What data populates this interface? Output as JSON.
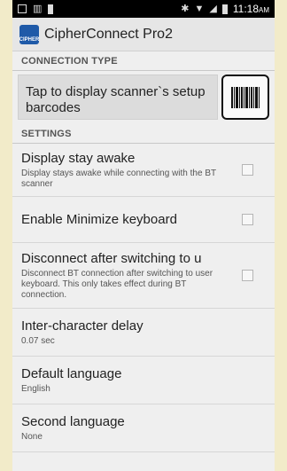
{
  "status_bar": {
    "time": "11:18",
    "ampm": "AM",
    "left_icons": [
      "screenshot-icon",
      "barcode-notification-icon",
      "sd-icon"
    ],
    "right_icons": [
      "bluetooth-icon",
      "wifi-icon",
      "signal-icon",
      "battery-icon"
    ]
  },
  "action_bar": {
    "title": "CipherConnect Pro2",
    "logo_text": "CIPHER"
  },
  "connection_type": {
    "header": "CONNECTION TYPE",
    "tap_text": "Tap to display scanner`s setup barcodes"
  },
  "settings": {
    "header": "SETTINGS",
    "items": [
      {
        "title": "Display stay awake",
        "summary": "Display stays awake while connecting with the BT scanner",
        "checked": false
      },
      {
        "title": "Enable Minimize keyboard",
        "summary": "",
        "checked": false
      },
      {
        "title": "Disconnect after switching to u",
        "summary": "Disconnect BT connection after switching to user keyboard. This only takes effect during BT connection.",
        "checked": false
      },
      {
        "title": "Inter-character delay",
        "summary": "0.07 sec"
      },
      {
        "title": "Default language",
        "summary": "English"
      },
      {
        "title": "Second language",
        "summary": "None"
      }
    ]
  }
}
